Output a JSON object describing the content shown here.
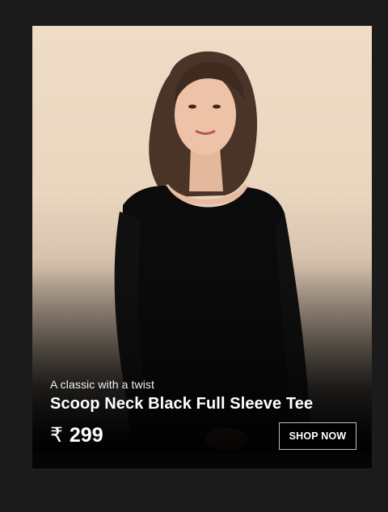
{
  "banner": {
    "tagline": "A classic with a twist",
    "product_name": "Scoop Neck Black Full Sleeve Tee",
    "currency_symbol": "₹",
    "price": "299",
    "cta_label": "SHOP NOW"
  },
  "colors": {
    "page_background": "#1b1b1b",
    "photo_backdrop": "#eedcc6",
    "text": "#ffffff",
    "button_background": "#000000",
    "button_border": "#bdbdbd"
  }
}
